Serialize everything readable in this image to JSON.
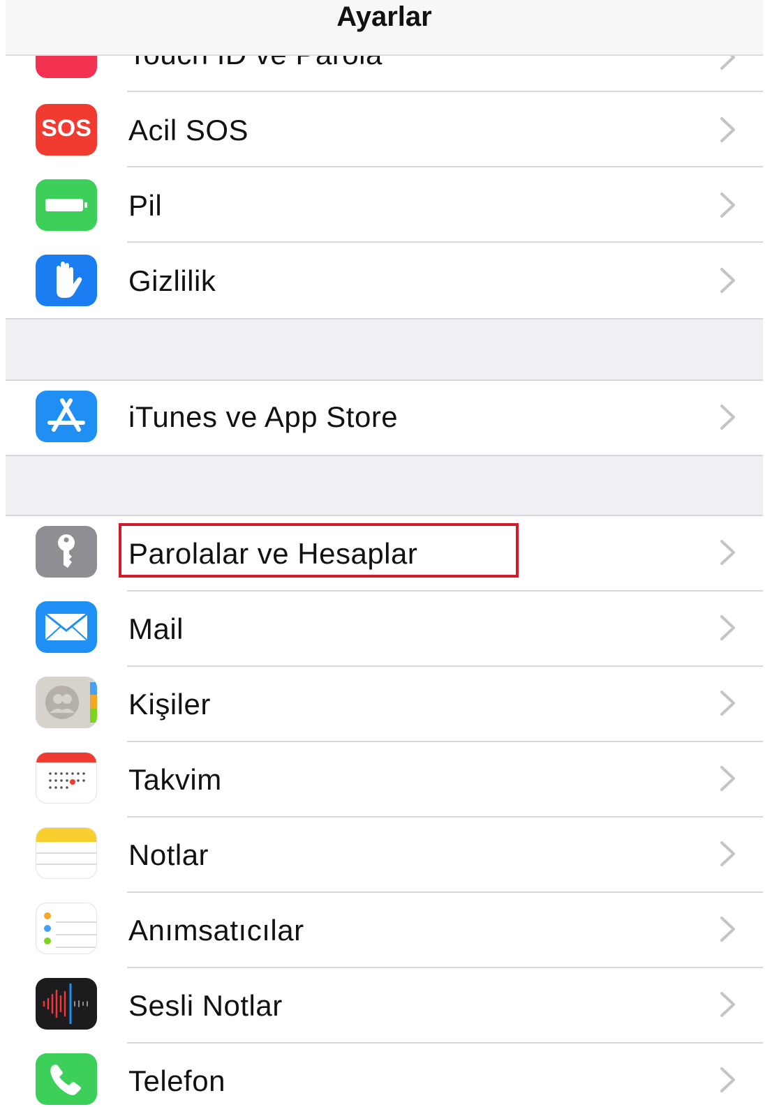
{
  "header": {
    "title": "Ayarlar"
  },
  "rows": {
    "touch_id": {
      "label": "Touch ID ve Parola",
      "icon": "fingerprint-icon",
      "color": "#f2304f"
    },
    "acil_sos": {
      "label": "Acil SOS",
      "icon_text": "SOS",
      "icon": "sos-icon",
      "color": "#f23b30"
    },
    "pil": {
      "label": "Pil",
      "icon": "battery-icon",
      "color": "#3ccf5a"
    },
    "gizlilik": {
      "label": "Gizlilik",
      "icon": "hand-icon",
      "color": "#1a7df2"
    },
    "itunes": {
      "label": "iTunes ve App Store",
      "icon": "app-store-icon",
      "color": "#1f8ff4"
    },
    "parolalar": {
      "label": "Parolalar ve Hesaplar",
      "icon": "key-icon",
      "color": "#8e8e93"
    },
    "mail": {
      "label": "Mail",
      "icon": "envelope-icon",
      "color": "#1e90f5"
    },
    "kisiler": {
      "label": "Kişiler",
      "icon": "contacts-icon",
      "color": "#c9c7c2"
    },
    "takvim": {
      "label": "Takvim",
      "icon": "calendar-icon",
      "color": "#f03b32"
    },
    "notlar": {
      "label": "Notlar",
      "icon": "notes-icon",
      "color": "#f8cf2f"
    },
    "animsaticilar": {
      "label": "Anımsatıcılar",
      "icon": "reminders-icon",
      "color": "#ffffff"
    },
    "sesli_notlar": {
      "label": "Sesli Notlar",
      "icon": "voice-memos-icon",
      "color": "#1c1c1e"
    },
    "telefon": {
      "label": "Telefon",
      "icon": "phone-icon",
      "color": "#3ccf5a"
    }
  },
  "highlight_color": "#d21a2a"
}
